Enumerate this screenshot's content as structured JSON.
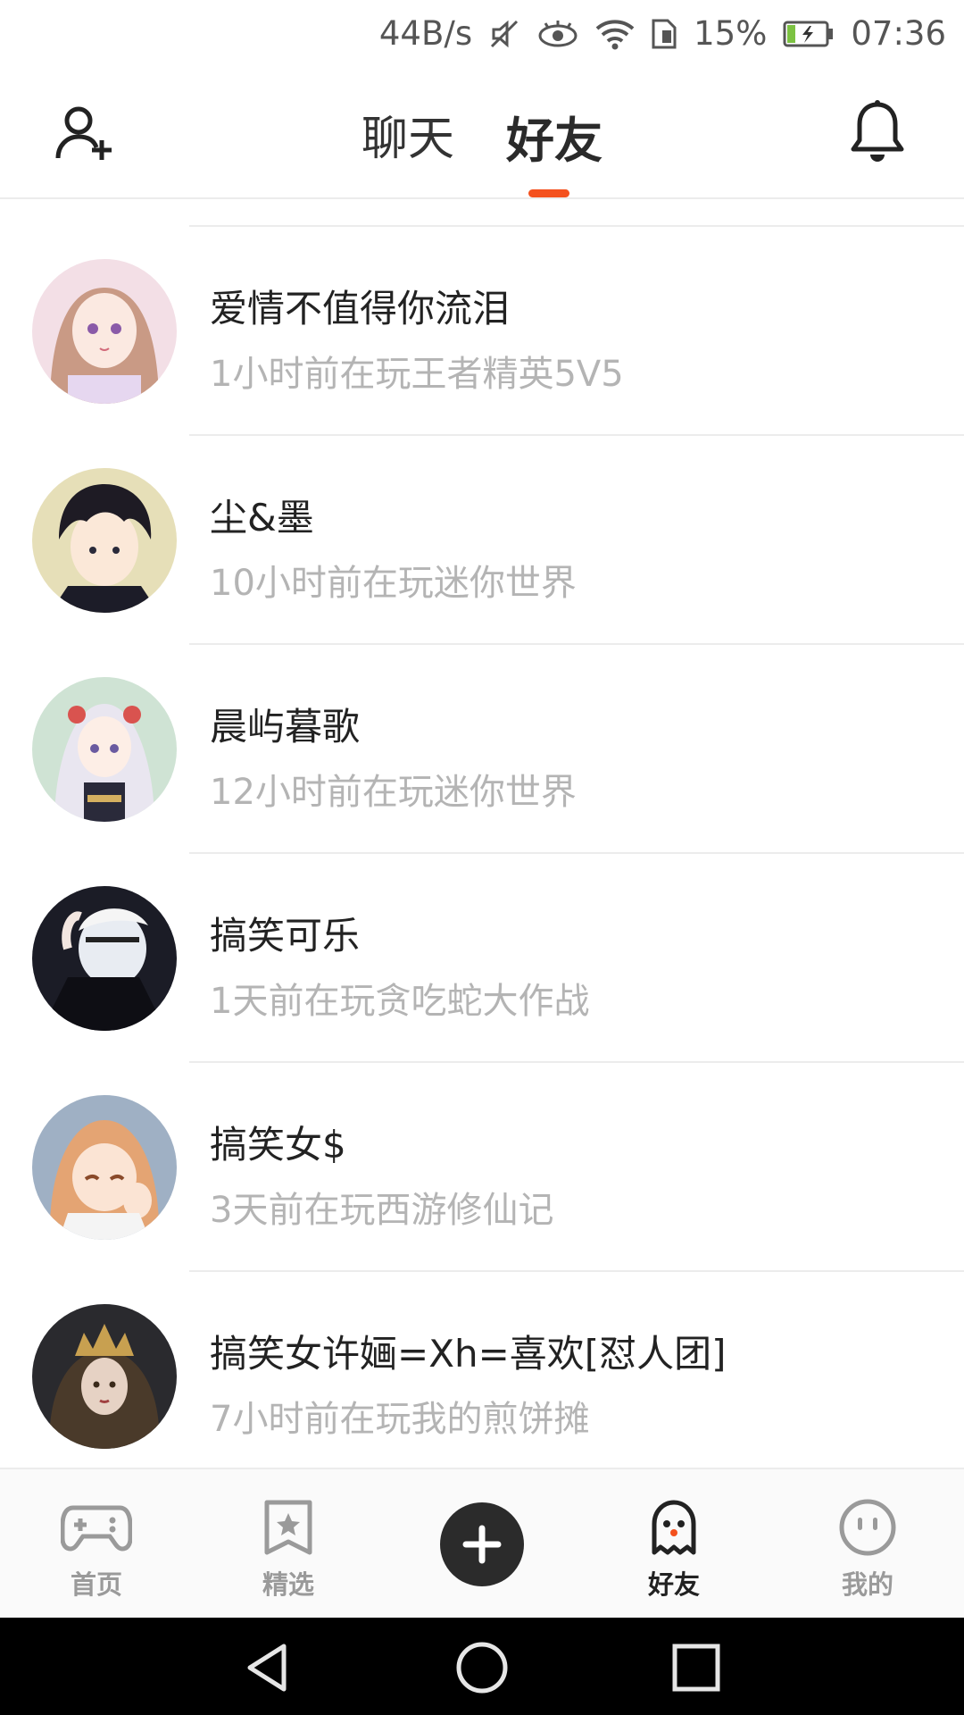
{
  "status_bar": {
    "net_speed": "44B/s",
    "battery_percent": "15%",
    "time": "07:36",
    "icons": [
      "mute-icon",
      "eye-icon",
      "wifi-icon",
      "sim-icon",
      "battery-charging-icon"
    ]
  },
  "header": {
    "tabs": [
      {
        "label": "聊天",
        "active": false
      },
      {
        "label": "好友",
        "active": true
      }
    ],
    "accent_color": "#f4511e"
  },
  "friends": [
    {
      "name": "爱情不值得你流泪",
      "activity": "1小时前在玩王者精英5V5"
    },
    {
      "name": "尘&墨",
      "activity": "10小时前在玩迷你世界"
    },
    {
      "name": "晨屿暮歌",
      "activity": "12小时前在玩迷你世界"
    },
    {
      "name": "搞笑可乐",
      "activity": "1天前在玩贪吃蛇大作战"
    },
    {
      "name": "搞笑女$",
      "activity": "3天前在玩西游修仙记"
    },
    {
      "name": "搞笑女许婳=Xh=喜欢[怼人团]",
      "activity": "7小时前在玩我的煎饼摊"
    }
  ],
  "bottom_nav": {
    "items": [
      {
        "label": "首页",
        "icon": "gamepad-icon"
      },
      {
        "label": "精选",
        "icon": "star-bookmark-icon"
      },
      {
        "label": "好友",
        "icon": "ghost-icon",
        "active": true
      },
      {
        "label": "我的",
        "icon": "face-icon"
      }
    ]
  }
}
